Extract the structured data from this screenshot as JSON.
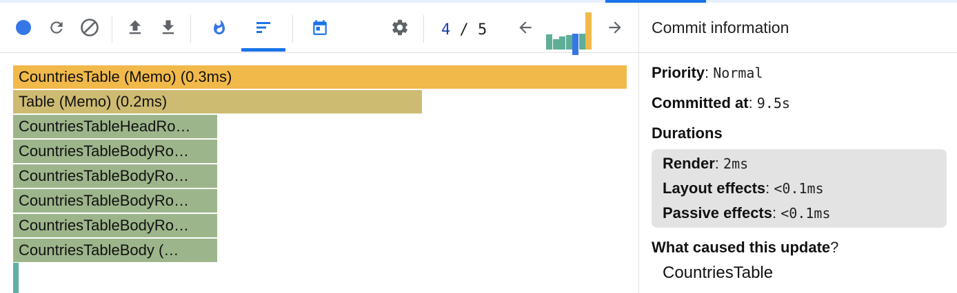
{
  "toolbar": {
    "buttons": [
      {
        "name": "record-button",
        "icon": "record-dot-icon",
        "color": "#3578e5"
      },
      {
        "name": "reload-and-profile-button",
        "icon": "reload-icon"
      },
      {
        "name": "clear-profiling-button",
        "icon": "clear-icon"
      },
      {
        "name": "load-profile-button",
        "icon": "upload-icon"
      },
      {
        "name": "save-profile-button",
        "icon": "download-icon"
      },
      {
        "name": "flame-chart-tab",
        "icon": "flame-icon",
        "color": "#3578e5"
      },
      {
        "name": "ranked-chart-tab",
        "icon": "ranked-icon",
        "color": "#1a73e8",
        "active": true
      },
      {
        "name": "timeline-tab",
        "icon": "calendar-icon",
        "color": "#1a73e8"
      },
      {
        "name": "settings-button",
        "icon": "gear-icon"
      }
    ],
    "commit": {
      "current": "4",
      "separator": " / ",
      "total": "5"
    },
    "commit_levels": [
      0.4,
      0.28,
      0.36,
      0.38,
      0.58,
      0.42,
      1.0
    ],
    "commit_colors": [
      "#5fae98",
      "#5fae98",
      "#5fae98",
      "#5fae98",
      "#3578e5",
      "#5fae98",
      "#f1b94a"
    ],
    "selected_commit_index": 4
  },
  "flamegraph": {
    "bars": [
      {
        "label": "CountriesTable (Memo) (0.3ms)",
        "width_fraction": 1.0,
        "color": "#f1b94a"
      },
      {
        "label": "Table (Memo) (0.2ms)",
        "width_fraction": 0.666,
        "color": "#cdbb72"
      },
      {
        "label": "CountriesTableHeadRo…",
        "width_fraction": 0.333,
        "color": "#9db58b"
      },
      {
        "label": "CountriesTableBodyRo…",
        "width_fraction": 0.333,
        "color": "#9db58b"
      },
      {
        "label": "CountriesTableBodyRo…",
        "width_fraction": 0.333,
        "color": "#9db58b"
      },
      {
        "label": "CountriesTableBodyRo…",
        "width_fraction": 0.333,
        "color": "#9db58b"
      },
      {
        "label": "CountriesTableBodyRo…",
        "width_fraction": 0.333,
        "color": "#9db58b"
      },
      {
        "label": "CountriesTableBody (…",
        "width_fraction": 0.333,
        "color": "#9db58b"
      }
    ]
  },
  "commit_info": {
    "title": "Commit information",
    "priority_label": "Priority",
    "priority_value": "Normal",
    "committed_label": "Committed at",
    "committed_value": "9.5s",
    "durations_label": "Durations",
    "render_label": "Render",
    "render_value": "2ms",
    "layout_label": "Layout effects",
    "layout_value": "<0.1ms",
    "passive_label": "Passive effects",
    "passive_value": "<0.1ms",
    "cause_label": "What caused this update",
    "cause_value": "CountriesTable"
  }
}
